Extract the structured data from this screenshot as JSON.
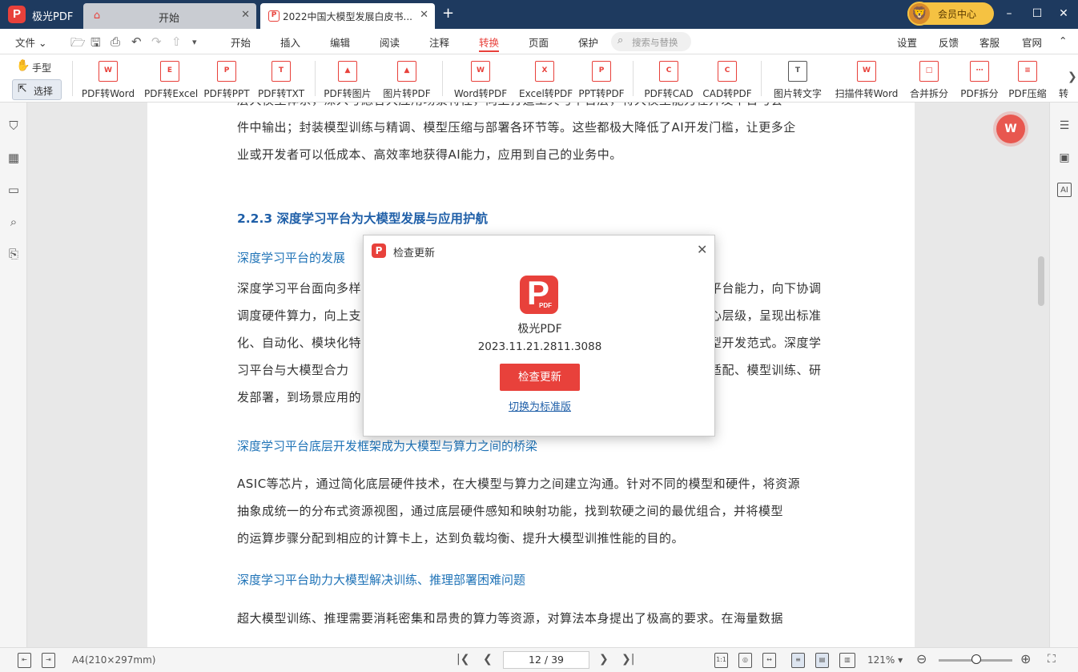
{
  "titlebar": {
    "app_name": "极光PDF",
    "tabs": [
      {
        "label": "开始"
      },
      {
        "label": "2022中国大模型发展白皮书..."
      }
    ],
    "vip_label": "会员中心"
  },
  "menubar": {
    "file": "文件",
    "items": [
      "开始",
      "插入",
      "编辑",
      "阅读",
      "注释",
      "转换",
      "页面",
      "保护"
    ],
    "active": "转换",
    "search_placeholder": "搜索与替换",
    "right_items": [
      "设置",
      "反馈",
      "客服",
      "官网"
    ]
  },
  "toolbar": {
    "hand": "手型",
    "select": "选择",
    "tools": [
      {
        "label": "PDF转Word",
        "glyph": "W"
      },
      {
        "label": "PDF转Excel",
        "glyph": "E"
      },
      {
        "label": "PDF转PPT",
        "glyph": "P"
      },
      {
        "label": "PDF转TXT",
        "glyph": "T"
      },
      {
        "label": "PDF转图片",
        "glyph": "▲"
      },
      {
        "label": "图片转PDF",
        "glyph": "▲"
      },
      {
        "label": "Word转PDF",
        "glyph": "W"
      },
      {
        "label": "Excel转PDF",
        "glyph": "X"
      },
      {
        "label": "PPT转PDF",
        "glyph": "P"
      },
      {
        "label": "PDF转CAD",
        "glyph": "C"
      },
      {
        "label": "CAD转PDF",
        "glyph": "C"
      },
      {
        "label": "图片转文字",
        "glyph": "T"
      },
      {
        "label": "扫描件转Word",
        "glyph": "W"
      },
      {
        "label": "合并拆分",
        "glyph": "□"
      },
      {
        "label": "PDF拆分",
        "glyph": "⋯"
      },
      {
        "label": "PDF压缩",
        "glyph": "≡"
      },
      {
        "label": "转",
        "glyph": ""
      }
    ]
  },
  "document": {
    "para0_lines": [
      "层大模型体系，深入考虑各大应用场景特性，向上打造工具与平台层，将大模型能力在开发平台与套",
      "件中输出；封装模型训练与精调、模型压缩与部署各环节等。这些都极大降低了AI开发门槛，让更多企",
      "业或开发者可以低成本、高效率地获得AI能力，应用到自己的业务中。"
    ],
    "heading": "2.2.3 深度学习平台为大模型发展与应用护航",
    "sub1": "深度学习平台的发展",
    "para1_lines": [
      "深度学习平台面向多样",
      "调度硬件算力，向上支",
      "化、自动化、模块化特",
      "习平台与大模型合力",
      "发部署，到场景应用的"
    ],
    "para1_right_lines": [
      "平台能力，向下协调",
      "心层级，呈现出标准",
      "型开发范式。深度学",
      "适配、模型训练、研",
      ""
    ],
    "sub2": "深度学习平台底层开发框架成为大模型与算力之间的桥梁",
    "para2_lines": [
      "ASIC等芯片，通过简化底层硬件技术，在大模型与算力之间建立沟通。针对不同的模型和硬件，将资源",
      "抽象成统一的分布式资源视图，通过底层硬件感知和映射功能，找到软硬之间的最优组合，并将模型",
      "的运算步骤分配到相应的计算卡上，达到负载均衡、提升大模型训推性能的目的。"
    ],
    "sub3": "深度学习平台助力大模型解决训练、推理部署困难问题",
    "para3_lines": [
      "超大模型训练、推理需要消耗密集和昂贵的算力等资源，对算法本身提出了极高的要求。在海量数据"
    ]
  },
  "dialog": {
    "title": "检查更新",
    "product": "极光PDF",
    "version": "2023.11.21.2811.3088",
    "button": "检查更新",
    "link": "切换为标准版",
    "logo_letter": "P",
    "logo_sub": "PDF"
  },
  "statusbar": {
    "paper": "A4(210×297mm)",
    "page": "12 / 39",
    "zoom": "121%"
  }
}
